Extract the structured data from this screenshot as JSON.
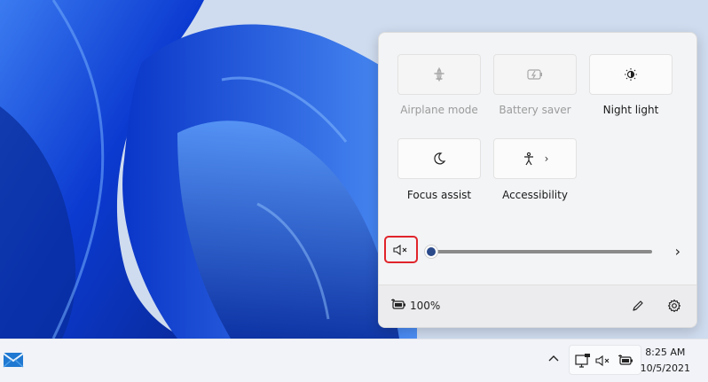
{
  "quick_settings": {
    "tiles": [
      {
        "label": "Airplane mode",
        "icon": "airplane-icon",
        "enabled": false
      },
      {
        "label": "Battery saver",
        "icon": "battery-saver-icon",
        "enabled": false
      },
      {
        "label": "Night light",
        "icon": "night-light-icon",
        "enabled": true
      },
      {
        "label": "Focus assist",
        "icon": "moon-icon",
        "enabled": true
      },
      {
        "label": "Accessibility",
        "icon": "accessibility-icon",
        "enabled": true,
        "chevron": "›"
      }
    ],
    "volume": {
      "muted": true,
      "level_percent": 0,
      "icon": "speaker-muted-icon",
      "chevron": "›"
    },
    "footer": {
      "battery_text": "100%",
      "battery_icon": "battery-charging-icon",
      "edit_icon": "pencil-icon",
      "settings_icon": "gear-icon"
    }
  },
  "taskbar": {
    "app_icon": "mail-icon",
    "overflow_chevron": "^",
    "tray_icons": [
      "network-icon",
      "speaker-muted-icon",
      "battery-charging-icon"
    ],
    "time": "8:25 AM",
    "date": "10/5/2021"
  },
  "colors": {
    "accent": "#2b5aa8",
    "highlight_box": "#e0242b",
    "wallpaper_blue": "#1040c8"
  }
}
